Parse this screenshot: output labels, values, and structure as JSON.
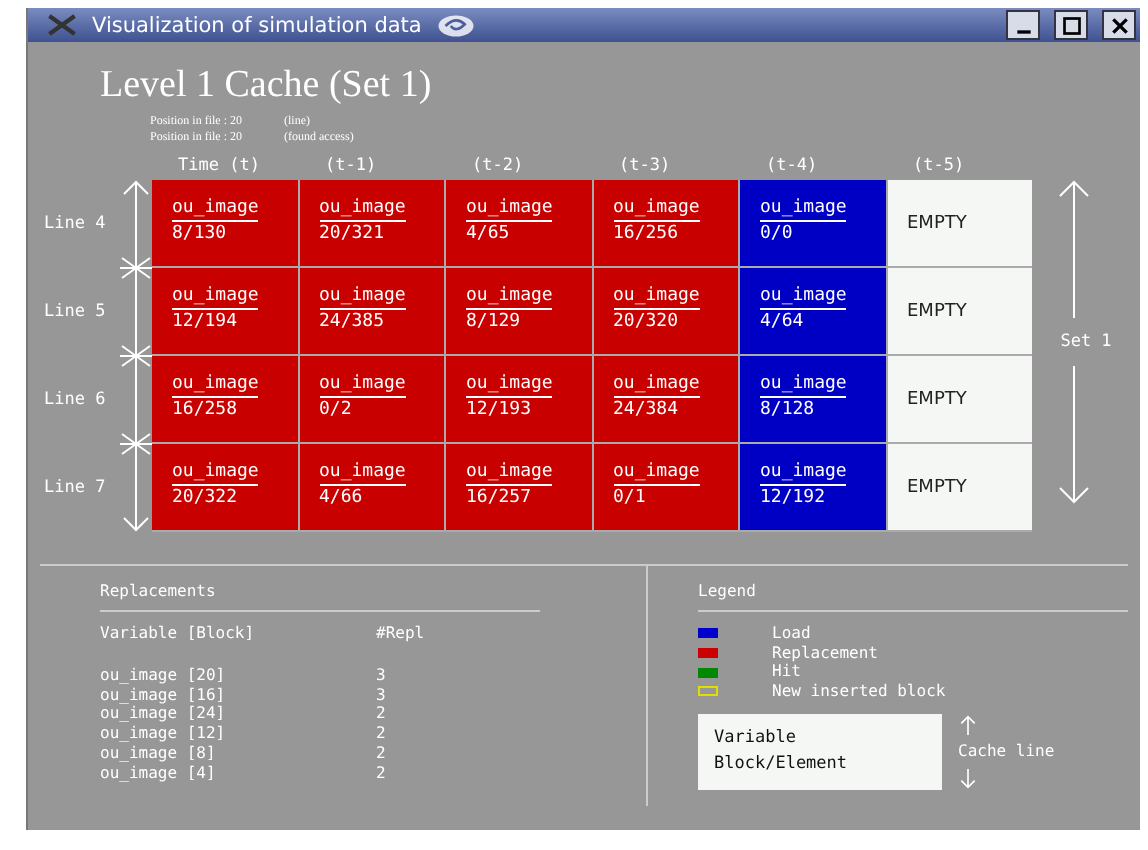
{
  "window": {
    "title": "Visualization of simulation data"
  },
  "heading": "Level 1 Cache (Set 1)",
  "positions": [
    {
      "label": "Position in file : 20",
      "note": "(line)"
    },
    {
      "label": "Position in file : 20",
      "note": "(found access)"
    }
  ],
  "columns": [
    "Time  (t)",
    "(t-1)",
    "(t-2)",
    "(t-3)",
    "(t-4)",
    "(t-5)"
  ],
  "lines": [
    {
      "label": "Line 4",
      "cells": [
        {
          "kind": "replacement",
          "variable": "ou_image",
          "block": "8/130"
        },
        {
          "kind": "replacement",
          "variable": "ou_image",
          "block": "20/321"
        },
        {
          "kind": "replacement",
          "variable": "ou_image",
          "block": "4/65"
        },
        {
          "kind": "replacement",
          "variable": "ou_image",
          "block": "16/256"
        },
        {
          "kind": "load",
          "variable": "ou_image",
          "block": "0/0"
        },
        {
          "kind": "empty",
          "variable": "EMPTY"
        }
      ]
    },
    {
      "label": "Line 5",
      "cells": [
        {
          "kind": "replacement",
          "variable": "ou_image",
          "block": "12/194"
        },
        {
          "kind": "replacement",
          "variable": "ou_image",
          "block": "24/385"
        },
        {
          "kind": "replacement",
          "variable": "ou_image",
          "block": "8/129"
        },
        {
          "kind": "replacement",
          "variable": "ou_image",
          "block": "20/320"
        },
        {
          "kind": "load",
          "variable": "ou_image",
          "block": "4/64"
        },
        {
          "kind": "empty",
          "variable": "EMPTY"
        }
      ]
    },
    {
      "label": "Line 6",
      "cells": [
        {
          "kind": "replacement",
          "variable": "ou_image",
          "block": "16/258"
        },
        {
          "kind": "replacement",
          "variable": "ou_image",
          "block": "0/2"
        },
        {
          "kind": "replacement",
          "variable": "ou_image",
          "block": "12/193"
        },
        {
          "kind": "replacement",
          "variable": "ou_image",
          "block": "24/384"
        },
        {
          "kind": "load",
          "variable": "ou_image",
          "block": "8/128"
        },
        {
          "kind": "empty",
          "variable": "EMPTY"
        }
      ]
    },
    {
      "label": "Line 7",
      "cells": [
        {
          "kind": "replacement",
          "variable": "ou_image",
          "block": "20/322"
        },
        {
          "kind": "replacement",
          "variable": "ou_image",
          "block": "4/66"
        },
        {
          "kind": "replacement",
          "variable": "ou_image",
          "block": "16/257"
        },
        {
          "kind": "replacement",
          "variable": "ou_image",
          "block": "0/1"
        },
        {
          "kind": "load",
          "variable": "ou_image",
          "block": "12/192"
        },
        {
          "kind": "empty",
          "variable": "EMPTY"
        }
      ]
    }
  ],
  "set_label": "Set 1",
  "replacements": {
    "title": "Replacements",
    "header": "Variable [Block]",
    "count_header": "#Repl",
    "rows": [
      {
        "variable": "ou_image [20]",
        "count": "3"
      },
      {
        "variable": "ou_image [16]",
        "count": "3"
      },
      {
        "variable": "ou_image [24]",
        "count": "2"
      },
      {
        "variable": "ou_image [12]",
        "count": "2"
      },
      {
        "variable": "ou_image [8]",
        "count": "2"
      },
      {
        "variable": "ou_image [4]",
        "count": "2"
      }
    ]
  },
  "legend": {
    "title": "Legend",
    "items": [
      {
        "label": "Load",
        "kind": "fill",
        "color": "#0000cc"
      },
      {
        "label": "Replacement",
        "kind": "fill",
        "color": "#cc0000"
      },
      {
        "label": "Hit",
        "kind": "fill",
        "color": "#008800"
      },
      {
        "label": "New inserted block",
        "kind": "outline",
        "color": "#e0e000"
      }
    ],
    "key": {
      "variable": "Variable",
      "block": "Block/Element",
      "line": "Cache line"
    }
  }
}
